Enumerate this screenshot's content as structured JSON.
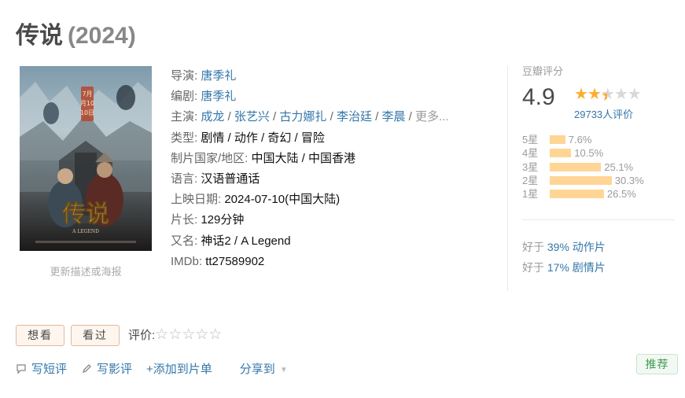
{
  "movie": {
    "title": "传说",
    "year": "(2024)"
  },
  "poster": {
    "title_art": "传说",
    "subtitle_art": "A LEGEND",
    "date_art": [
      "7月",
      "月10",
      "10日"
    ],
    "update_link": "更新描述或海报"
  },
  "info": {
    "director_label": "导演:",
    "director": "唐季礼",
    "writer_label": "编剧:",
    "writer": "唐季礼",
    "cast_label": "主演:",
    "cast": [
      "成龙",
      "张艺兴",
      "古力娜扎",
      "李治廷",
      "李晨"
    ],
    "cast_more": "更多...",
    "genre_label": "类型:",
    "genre": "剧情 / 动作 / 奇幻 / 冒险",
    "country_label": "制片国家/地区:",
    "country": "中国大陆 / 中国香港",
    "language_label": "语言:",
    "language": "汉语普通话",
    "release_label": "上映日期:",
    "release": "2024-07-10(中国大陆)",
    "runtime_label": "片长:",
    "runtime": "129分钟",
    "aka_label": "又名:",
    "aka": "神话2 / A Legend",
    "imdb_label": "IMDb:",
    "imdb": "tt27589902"
  },
  "rating": {
    "label": "豆瓣评分",
    "score": "4.9",
    "stars_value": 2.5,
    "stars_max": 5,
    "count": "29733人评价",
    "distribution": [
      {
        "level": "5星",
        "pct_text": "7.6%",
        "pct": 7.6
      },
      {
        "level": "4星",
        "pct_text": "10.5%",
        "pct": 10.5
      },
      {
        "level": "3星",
        "pct_text": "25.1%",
        "pct": 25.1
      },
      {
        "level": "2星",
        "pct_text": "30.3%",
        "pct": 30.3
      },
      {
        "level": "1星",
        "pct_text": "26.5%",
        "pct": 26.5
      }
    ],
    "better_than": [
      {
        "prefix": "好于",
        "value": "39% 动作片"
      },
      {
        "prefix": "好于",
        "value": "17% 剧情片"
      }
    ]
  },
  "actions": {
    "want_to_watch": "想看",
    "watched": "看过",
    "rate_label": "评价:",
    "rate_stars": "☆☆☆☆☆"
  },
  "links": {
    "write_short_review": "写短评",
    "write_review": "写影评",
    "add_to_list": "+添加到片单",
    "share": "分享到"
  },
  "recommend": "推荐",
  "colors": {
    "link": "#3377aa",
    "star": "#ffac2d",
    "bar": "#ffd596",
    "recommend_text": "#3d9a51"
  }
}
